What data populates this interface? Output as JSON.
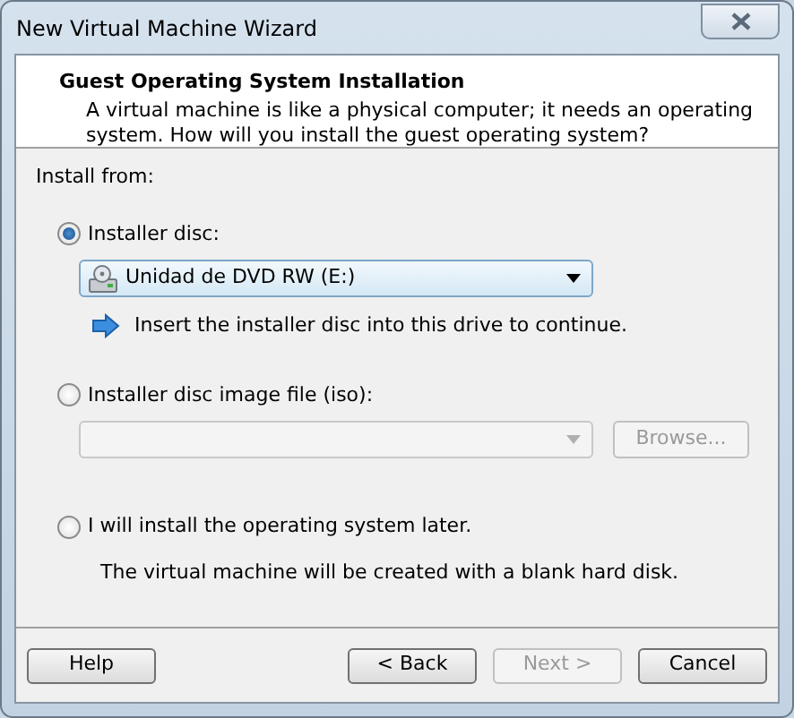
{
  "window": {
    "title": "New Virtual Machine Wizard"
  },
  "header": {
    "title": "Guest Operating System Installation",
    "description": "A virtual machine is like a physical computer; it needs an operating system. How will you install the guest operating system?"
  },
  "install_from": "Install from:",
  "options": [
    {
      "label": "Installer disc:",
      "selected": true,
      "dropdown": {
        "value": "Unidad de DVD RW (E:)",
        "disabled": false
      },
      "hint": "Insert the installer disc into this drive to continue."
    },
    {
      "label": "Installer disc image file (iso):",
      "selected": false,
      "dropdown": {
        "disabled": true
      },
      "browse": {
        "label": "Browse...",
        "disabled": true
      }
    },
    {
      "label": "I will install the operating system later.",
      "selected": false,
      "note": "The virtual machine will be created with a blank hard disk."
    }
  ],
  "buttons": [
    {
      "label": "Help",
      "disabled": false
    },
    {
      "label": "< Back",
      "disabled": false
    },
    {
      "label": "Next >",
      "disabled": true
    },
    {
      "label": "Cancel",
      "disabled": false
    }
  ]
}
